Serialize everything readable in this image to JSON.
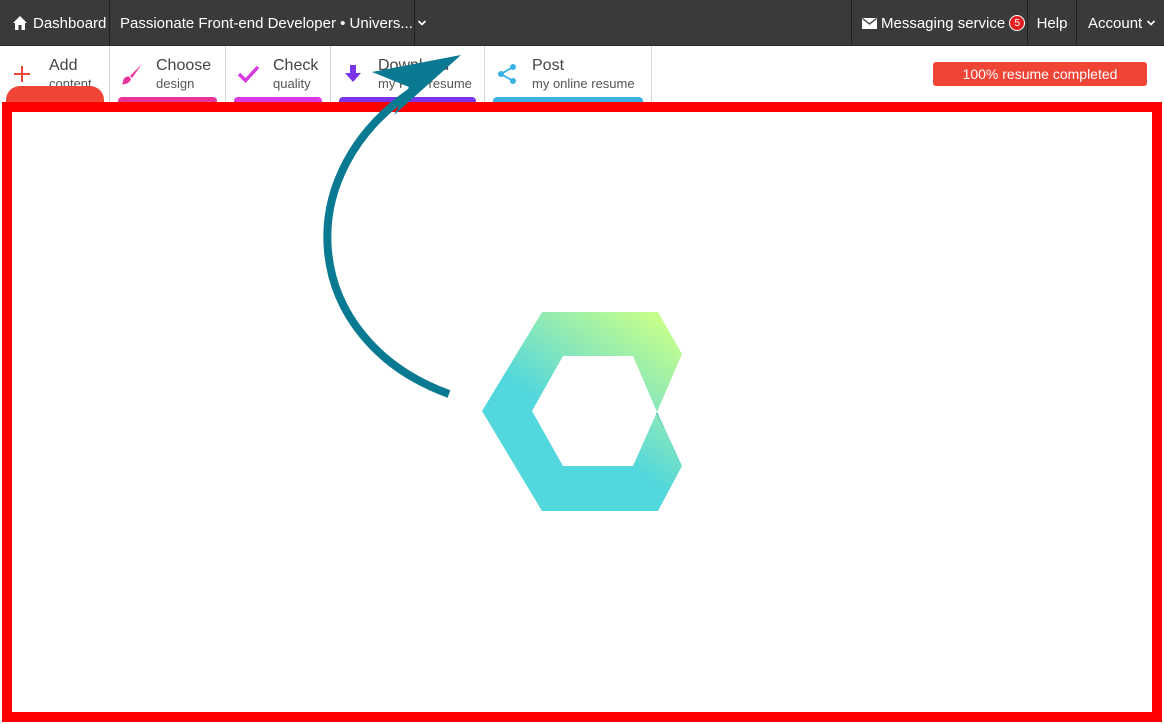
{
  "topbar": {
    "dashboard_label": "Dashboard",
    "resume_title": "Passionate Front-end Developer • Univers...",
    "messaging_label": "Messaging service",
    "messaging_count": "5",
    "help_label": "Help",
    "account_label": "Account"
  },
  "toolbar": {
    "tools": [
      {
        "title": "Add",
        "subtitle": "content",
        "color": "#f04436"
      },
      {
        "title": "Choose",
        "subtitle": "design",
        "color": "#e8339b"
      },
      {
        "title": "Check",
        "subtitle": "quality",
        "color": "#d63ae0"
      },
      {
        "title": "Download",
        "subtitle": "my PDF resume",
        "color": "#7b35e8"
      },
      {
        "title": "Post",
        "subtitle": "my online resume",
        "color": "#3ab2e6"
      }
    ],
    "progress_label": "100% resume completed"
  },
  "colors": {
    "topbar_bg": "#3a3a3a",
    "frame_border": "#ff0000",
    "arrow": "#0a7a93",
    "logo_top": "#c6ff8a",
    "logo_bottom": "#52d7dc"
  },
  "icons": [
    "home-icon",
    "chevron-down-icon",
    "envelope-icon",
    "plus-icon",
    "brush-icon",
    "check-icon",
    "download-icon",
    "share-icon",
    "logo-icon",
    "arrow-icon"
  ]
}
